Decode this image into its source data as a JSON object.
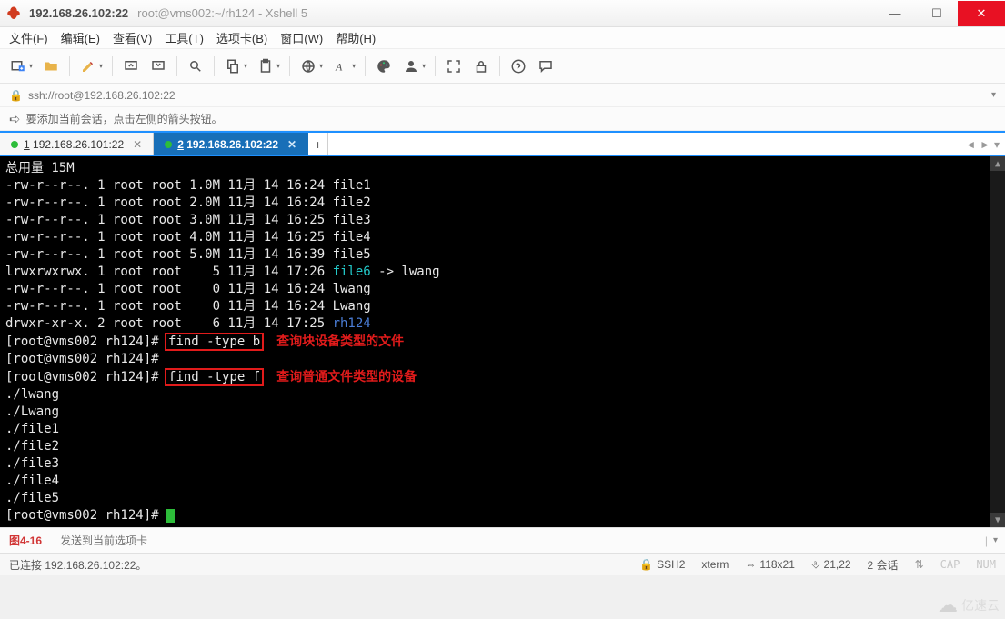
{
  "title": {
    "host": "192.168.26.102:22",
    "subtitle": "root@vms002:~/rh124 - Xshell 5"
  },
  "winbtns": {
    "min": "—",
    "max": "☐",
    "close": "✕"
  },
  "menu": {
    "file": "文件(F)",
    "edit": "编辑(E)",
    "view": "查看(V)",
    "tools": "工具(T)",
    "tabs": "选项卡(B)",
    "window": "窗口(W)",
    "help": "帮助(H)"
  },
  "toolbar_icons": {
    "new": "new-window-icon",
    "open": "open-icon",
    "pencil": "edit-icon",
    "reconnect": "reconnect-icon",
    "disconnect": "disconnect-icon",
    "find": "find-icon",
    "copy": "copy-icon",
    "paste": "paste-icon",
    "globe": "globe-icon",
    "font": "font-icon",
    "palette": "palette-icon",
    "user": "user-icon",
    "fullscreen": "fullscreen-icon",
    "lock": "lock-icon",
    "help": "help-icon",
    "chat": "chat-icon"
  },
  "address": {
    "lock_icon": "🔒",
    "url": "ssh://root@192.168.26.102:22"
  },
  "hint": {
    "arrow": "➪",
    "text": "要添加当前会话，点击左侧的箭头按钮。"
  },
  "tabs": {
    "items": [
      {
        "status": "green",
        "shortcut": "1",
        "label": "192.168.26.101:22",
        "active": false
      },
      {
        "status": "green",
        "shortcut": "2",
        "label": "192.168.26.102:22",
        "active": true
      }
    ],
    "add": "+"
  },
  "terminal": {
    "lines_top": [
      "总用量 15M",
      "-rw-r--r--. 1 root root 1.0M 11月 14 16:24 file1",
      "-rw-r--r--. 1 root root 2.0M 11月 14 16:24 file2",
      "-rw-r--r--. 1 root root 3.0M 11月 14 16:25 file3",
      "-rw-r--r--. 1 root root 4.0M 11月 14 16:25 file4",
      "-rw-r--r--. 1 root root 5.0M 11月 14 16:39 file5"
    ],
    "link_line_pre": "lrwxrwxrwx. 1 root root    5 11月 14 17:26 ",
    "link_name": "file6",
    "link_target": " -> lwang",
    "lines_mid": [
      "-rw-r--r--. 1 root root    0 11月 14 16:24 lwang",
      "-rw-r--r--. 1 root root    0 11月 14 16:24 Lwang"
    ],
    "dir_line_pre": "drwxr-xr-x. 2 root root    6 11月 14 17:25 ",
    "dir_name": "rh124",
    "prompt1_pre": "[root@vms002 rh124]# ",
    "cmd1": "find -type b",
    "label1": "查询块设备类型的文件",
    "prompt2": "[root@vms002 rh124]#",
    "prompt3_pre": "[root@vms002 rh124]# ",
    "cmd2": "find -type f",
    "label2": "查询普通文件类型的设备",
    "results": [
      "./lwang",
      "./Lwang",
      "./file1",
      "./file2",
      "./file3",
      "./file4",
      "./file5"
    ],
    "prompt_end": "[root@vms002 rh124]# "
  },
  "composer": {
    "figlabel": "图4-16",
    "placeholder": "发送到当前选项卡",
    "pipe": "|"
  },
  "status": {
    "connected": "已连接 192.168.26.102:22。",
    "ssh": "SSH2",
    "termtype": "xterm",
    "size": "118x21",
    "cursor": "21,22",
    "sessions": "2 会话",
    "caps": "CAP",
    "num": "NUM"
  },
  "watermark": {
    "text": "亿速云"
  }
}
